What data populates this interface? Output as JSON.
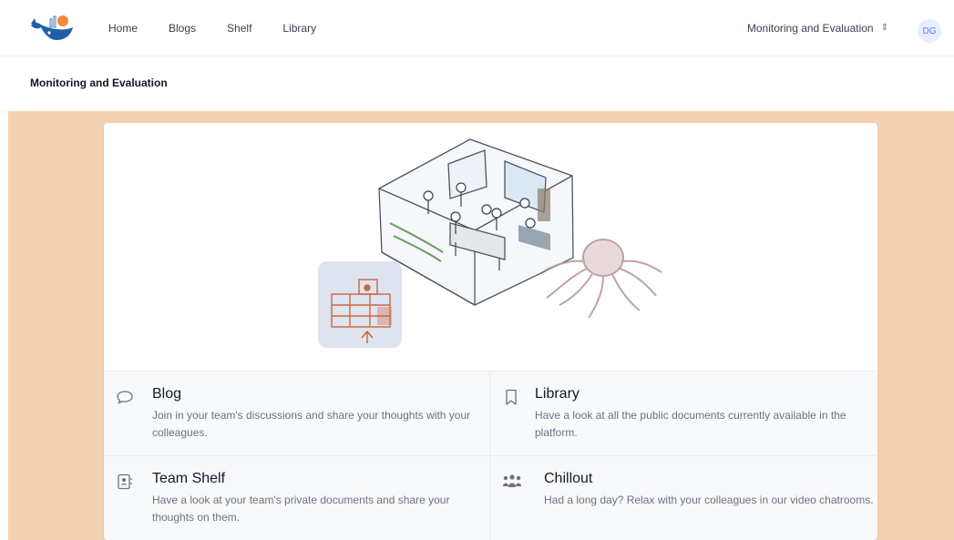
{
  "nav": {
    "links": [
      "Home",
      "Blogs",
      "Shelf",
      "Library"
    ],
    "team_selector": "Monitoring and Evaluation",
    "avatar_initials": "DG"
  },
  "page": {
    "title": "Monitoring and Evaluation"
  },
  "features": [
    {
      "title": "Blog",
      "description": "Join in your team's discussions and share your thoughts with your colleagues.",
      "icon": "speech-bubble-icon"
    },
    {
      "title": "Library",
      "description": "Have a look at all the public documents currently available in the platform.",
      "icon": "bookmark-icon"
    },
    {
      "title": "Team Shelf",
      "description": "Have a look at your team's private documents and share your thoughts on them.",
      "icon": "contact-book-icon"
    },
    {
      "title": "Chillout",
      "description": "Had a long day? Relax with your colleagues in our video chatrooms.",
      "icon": "group-icon"
    }
  ],
  "colors": {
    "background_accent": "#f4d3b2",
    "logo_blue": "#1f5fa8",
    "logo_orange": "#f08a3c",
    "avatar_bg": "#e8eefe"
  }
}
